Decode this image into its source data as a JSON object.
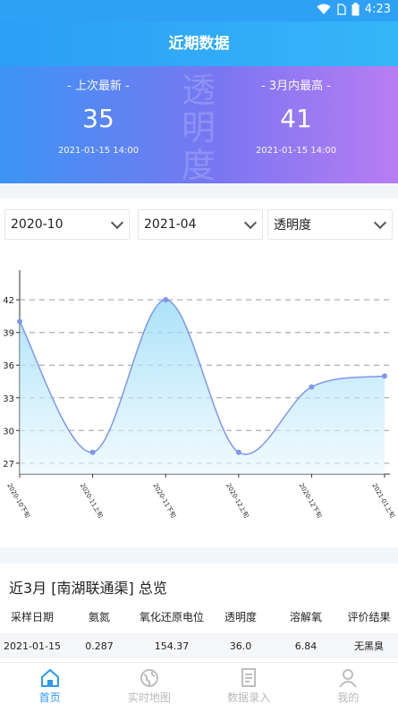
{
  "status": {
    "time": "4:23"
  },
  "header": {
    "title": "近期数据"
  },
  "hero": {
    "watermark": "透明度",
    "left": {
      "label": "- 上次最新 -",
      "value": "35",
      "time": "2021-01-15 14:00"
    },
    "right": {
      "label": "- 3月内最高 -",
      "value": "41",
      "time": "2021-01-15 14:00"
    }
  },
  "filters": {
    "start": "2020-10",
    "end": "2021-04",
    "metric": "透明度"
  },
  "chart_data": {
    "type": "line",
    "categories": [
      "2020-10下旬",
      "2020-11上旬",
      "2020-11下旬",
      "2020-12上旬",
      "2020-12下旬",
      "2021-01上旬"
    ],
    "values": [
      40,
      28,
      42,
      28,
      34,
      35
    ],
    "yticks": [
      27,
      30,
      33,
      36,
      39,
      42
    ],
    "ylim": [
      26,
      43
    ],
    "grid": true,
    "color": "#7f96ea"
  },
  "table": {
    "title": "近3月 [南湖联通渠] 总览",
    "headers": [
      "采样日期",
      "氨氮",
      "氧化还原电位",
      "透明度",
      "溶解氧",
      "评价结果"
    ],
    "rows": [
      [
        "2021-01-15",
        "0.287",
        "154.37",
        "36.0",
        "6.84",
        "无黑臭"
      ]
    ]
  },
  "tabs": [
    {
      "label": "首页",
      "icon": "home-icon"
    },
    {
      "label": "实时地图",
      "icon": "globe-icon"
    },
    {
      "label": "数据录入",
      "icon": "document-icon"
    },
    {
      "label": "我的",
      "icon": "user-icon"
    }
  ]
}
